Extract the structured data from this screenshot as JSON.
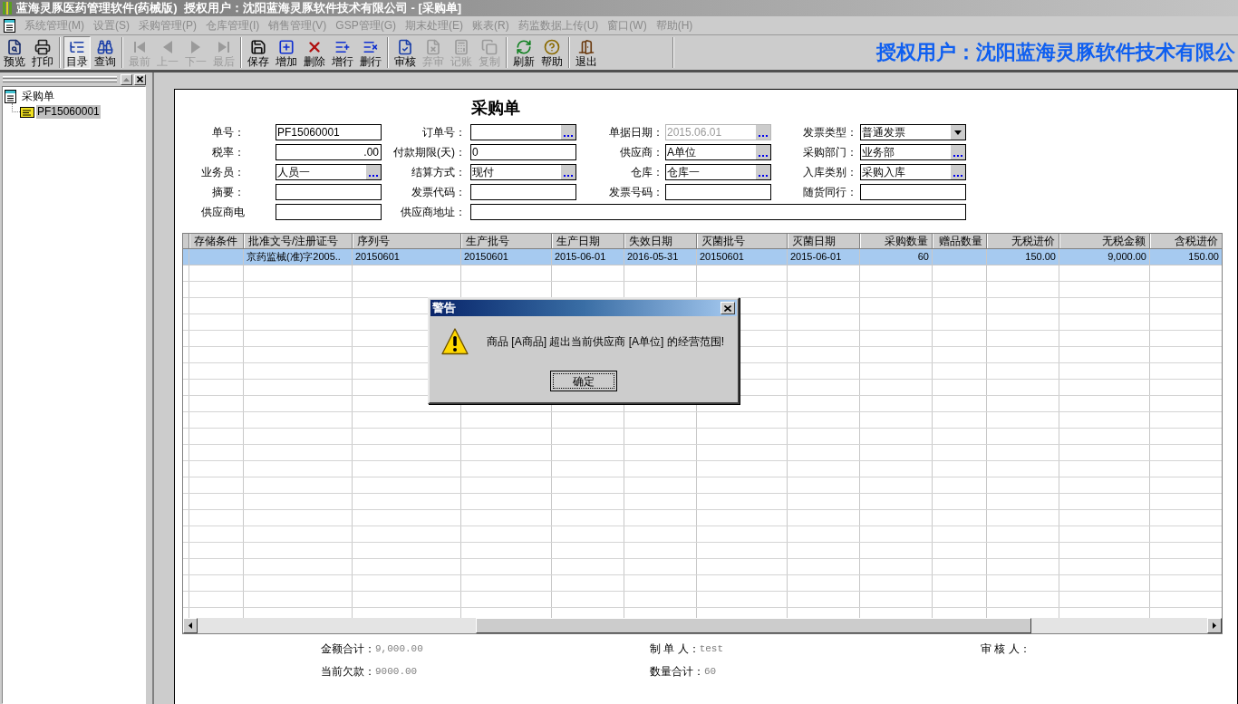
{
  "title_bar": {
    "title": "蓝海灵豚医药管理软件(药械版)  授权用户：沈阳蓝海灵豚软件技术有限公司 - [采购单]"
  },
  "menu": [
    {
      "label": "系统管理(M)",
      "disabled": true
    },
    {
      "label": "设置(S)",
      "disabled": true
    },
    {
      "label": "采购管理(P)",
      "disabled": true
    },
    {
      "label": "仓库管理(I)",
      "disabled": true
    },
    {
      "label": "销售管理(V)",
      "disabled": true
    },
    {
      "label": "GSP管理(G)",
      "disabled": true
    },
    {
      "label": "期末处理(E)",
      "disabled": true
    },
    {
      "label": "账表(R)",
      "disabled": true
    },
    {
      "label": "药监数据上传(U)",
      "disabled": true
    },
    {
      "label": "窗口(W)",
      "disabled": true
    },
    {
      "label": "帮助(H)",
      "disabled": true
    }
  ],
  "toolbar": {
    "groups": [
      [
        {
          "label": "预览",
          "disabled": false,
          "pressed": false
        },
        {
          "label": "打印",
          "disabled": false,
          "pressed": false
        }
      ],
      [
        {
          "label": "目录",
          "disabled": false,
          "pressed": true
        },
        {
          "label": "查询",
          "disabled": false,
          "pressed": false
        }
      ],
      [
        {
          "label": "最前",
          "disabled": true,
          "pressed": false
        },
        {
          "label": "上一",
          "disabled": true,
          "pressed": false
        },
        {
          "label": "下一",
          "disabled": true,
          "pressed": false
        },
        {
          "label": "最后",
          "disabled": true,
          "pressed": false
        }
      ],
      [
        {
          "label": "保存",
          "disabled": false,
          "pressed": false
        },
        {
          "label": "增加",
          "disabled": false,
          "pressed": false
        },
        {
          "label": "删除",
          "disabled": false,
          "pressed": false
        },
        {
          "label": "增行",
          "disabled": false,
          "pressed": false
        },
        {
          "label": "删行",
          "disabled": false,
          "pressed": false
        }
      ],
      [
        {
          "label": "审核",
          "disabled": false,
          "pressed": false
        },
        {
          "label": "弃审",
          "disabled": true,
          "pressed": false
        },
        {
          "label": "记账",
          "disabled": true,
          "pressed": false
        },
        {
          "label": "复制",
          "disabled": true,
          "pressed": false
        }
      ],
      [
        {
          "label": "刷新",
          "disabled": false,
          "pressed": false
        },
        {
          "label": "帮助",
          "disabled": false,
          "pressed": false
        }
      ],
      [
        {
          "label": "退出",
          "disabled": false,
          "pressed": false
        }
      ]
    ],
    "banner": "授权用户：沈阳蓝海灵豚软件技术有限公"
  },
  "sidebar": {
    "tree": [
      {
        "label": "采购单",
        "selected": false,
        "children": [
          {
            "label": "PF15060001",
            "selected": true
          }
        ]
      }
    ]
  },
  "form": {
    "title": "采购单",
    "rows": [
      [
        {
          "label": "单号：",
          "value": "PF15060001",
          "kind": "text",
          "disabled": false
        },
        {
          "label": "订单号：",
          "kind": "lookup",
          "disabled": false
        },
        {
          "label": "单据日期：",
          "value": "2015.06.01",
          "kind": "lookup",
          "disabled": true
        },
        {
          "label": "发票类型：",
          "value": "普通发票",
          "kind": "dropdown",
          "disabled": false
        }
      ],
      [
        {
          "label": "税率：",
          "value": ".00",
          "kind": "number",
          "disabled": false
        },
        {
          "label": "付款期限(天)：",
          "value": "0",
          "kind": "text",
          "disabled": false
        },
        {
          "label": "供应商：",
          "value": "A单位",
          "kind": "lookup",
          "disabled": false
        },
        {
          "label": "采购部门：",
          "value": "业务部",
          "kind": "lookup",
          "disabled": false
        }
      ],
      [
        {
          "label": "业务员：",
          "value": "人员一",
          "kind": "lookup",
          "disabled": false
        },
        {
          "label": "结算方式：",
          "value": "现付",
          "kind": "lookup",
          "disabled": false
        },
        {
          "label": "仓库：",
          "value": "仓库一",
          "kind": "lookup",
          "disabled": false
        },
        {
          "label": "入库类别：",
          "value": "采购入库",
          "kind": "lookup",
          "disabled": false
        }
      ],
      [
        {
          "label": "摘要：",
          "kind": "text",
          "disabled": false
        },
        {
          "label": "发票代码：",
          "kind": "text",
          "disabled": false
        },
        {
          "label": "发票号码：",
          "kind": "text",
          "disabled": false
        },
        {
          "label": "随货同行：",
          "kind": "text",
          "disabled": false
        }
      ],
      [
        {
          "label": "供应商电",
          "kind": "text",
          "disabled": false
        },
        {
          "label": "供应商地址：",
          "kind": "text",
          "disabled": false
        }
      ]
    ]
  },
  "table": {
    "columns": [
      {
        "label": "存储条件",
        "kind": "text"
      },
      {
        "label": "批准文号/注册证号",
        "kind": "text"
      },
      {
        "label": "序列号",
        "kind": "text"
      },
      {
        "label": "生产批号",
        "kind": "text"
      },
      {
        "label": "生产日期",
        "kind": "text"
      },
      {
        "label": "失效日期",
        "kind": "text"
      },
      {
        "label": "灭菌批号",
        "kind": "text"
      },
      {
        "label": "灭菌日期",
        "kind": "text"
      },
      {
        "label": "采购数量",
        "kind": "number"
      },
      {
        "label": "赠品数量",
        "kind": "number"
      },
      {
        "label": "无税进价",
        "kind": "number"
      },
      {
        "label": "无税金额",
        "kind": "number"
      },
      {
        "label": "含税进价",
        "kind": "number"
      }
    ],
    "rows": [
      {
        "selected": true,
        "cells": [
          null,
          "京药监械(准)字2005..",
          "20150601",
          "20150601",
          "2015-06-01",
          "2016-05-31",
          "20150601",
          "2015-06-01",
          "60",
          null,
          "150.00",
          "9,000.00",
          "150.00"
        ]
      }
    ]
  },
  "summary": [
    [
      {
        "label": "金额合计：",
        "value": "9,000.00"
      },
      {
        "label": "制 单 人：",
        "value": "test"
      },
      {
        "label": "审 核 人："
      }
    ],
    [
      {
        "label": "当前欠款：",
        "value": "9000.00"
      },
      {
        "label": "数量合计：",
        "value": "60"
      }
    ]
  ],
  "dialog": {
    "title": "警告",
    "message": "商品 [A商品] 超出当前供应商 [A单位] 的经营范围!",
    "buttons": [
      {
        "label": "确定",
        "focused": true
      }
    ]
  }
}
